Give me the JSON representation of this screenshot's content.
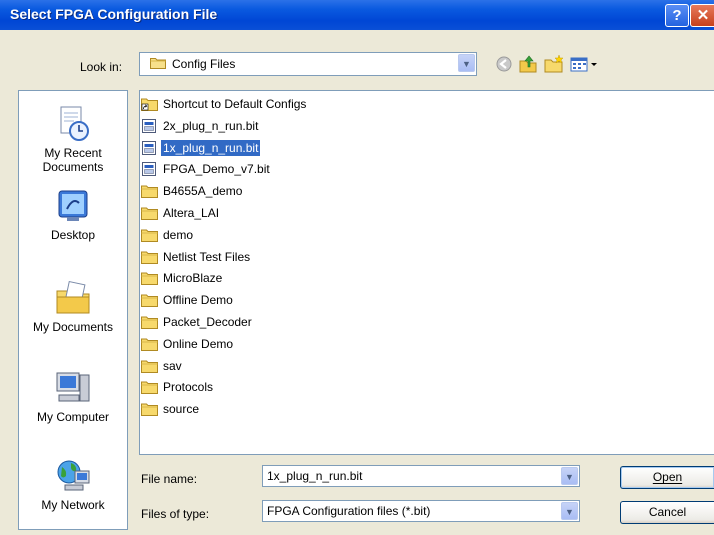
{
  "window": {
    "title": "Select FPGA Configuration File",
    "help_glyph": "?",
    "close_glyph": "✕"
  },
  "lookin": {
    "label": "Look in:",
    "value": "Config Files"
  },
  "toolbar": {
    "back_icon": "back-icon",
    "up_icon": "up-folder-icon",
    "newfolder_icon": "new-folder-icon",
    "views_icon": "views-menu-icon"
  },
  "places": [
    {
      "label": "My Recent\nDocuments",
      "icon": "recent-documents-icon"
    },
    {
      "label": "Desktop",
      "icon": "desktop-icon"
    },
    {
      "label": "My Documents",
      "icon": "my-documents-icon"
    },
    {
      "label": "My Computer",
      "icon": "my-computer-icon"
    },
    {
      "label": "My Network",
      "icon": "my-network-icon"
    }
  ],
  "files": [
    {
      "name": "Shortcut to Default Configs",
      "type": "shortcut"
    },
    {
      "name": "2x_plug_n_run.bit",
      "type": "file"
    },
    {
      "name": "1x_plug_n_run.bit",
      "type": "file",
      "selected": true
    },
    {
      "name": "FPGA_Demo_v7.bit",
      "type": "file"
    },
    {
      "name": "B4655A_demo",
      "type": "folder"
    },
    {
      "name": "Altera_LAI",
      "type": "folder"
    },
    {
      "name": "demo",
      "type": "folder"
    },
    {
      "name": "Netlist Test Files",
      "type": "folder"
    },
    {
      "name": "MicroBlaze",
      "type": "folder"
    },
    {
      "name": "Offline Demo",
      "type": "folder"
    },
    {
      "name": "Packet_Decoder",
      "type": "folder"
    },
    {
      "name": "Online Demo",
      "type": "folder"
    },
    {
      "name": "sav",
      "type": "folder"
    },
    {
      "name": "Protocols",
      "type": "folder"
    },
    {
      "name": "source",
      "type": "folder"
    }
  ],
  "filename": {
    "label": "File name:",
    "value": "1x_plug_n_run.bit"
  },
  "filetype": {
    "label": "Files of type:",
    "value": "FPGA Configuration files (*.bit)"
  },
  "buttons": {
    "open": "Open",
    "cancel": "Cancel"
  },
  "colors": {
    "selection": "#316ac5",
    "titlebar": "#0a5ae0",
    "dialog": "#ece9d8"
  }
}
